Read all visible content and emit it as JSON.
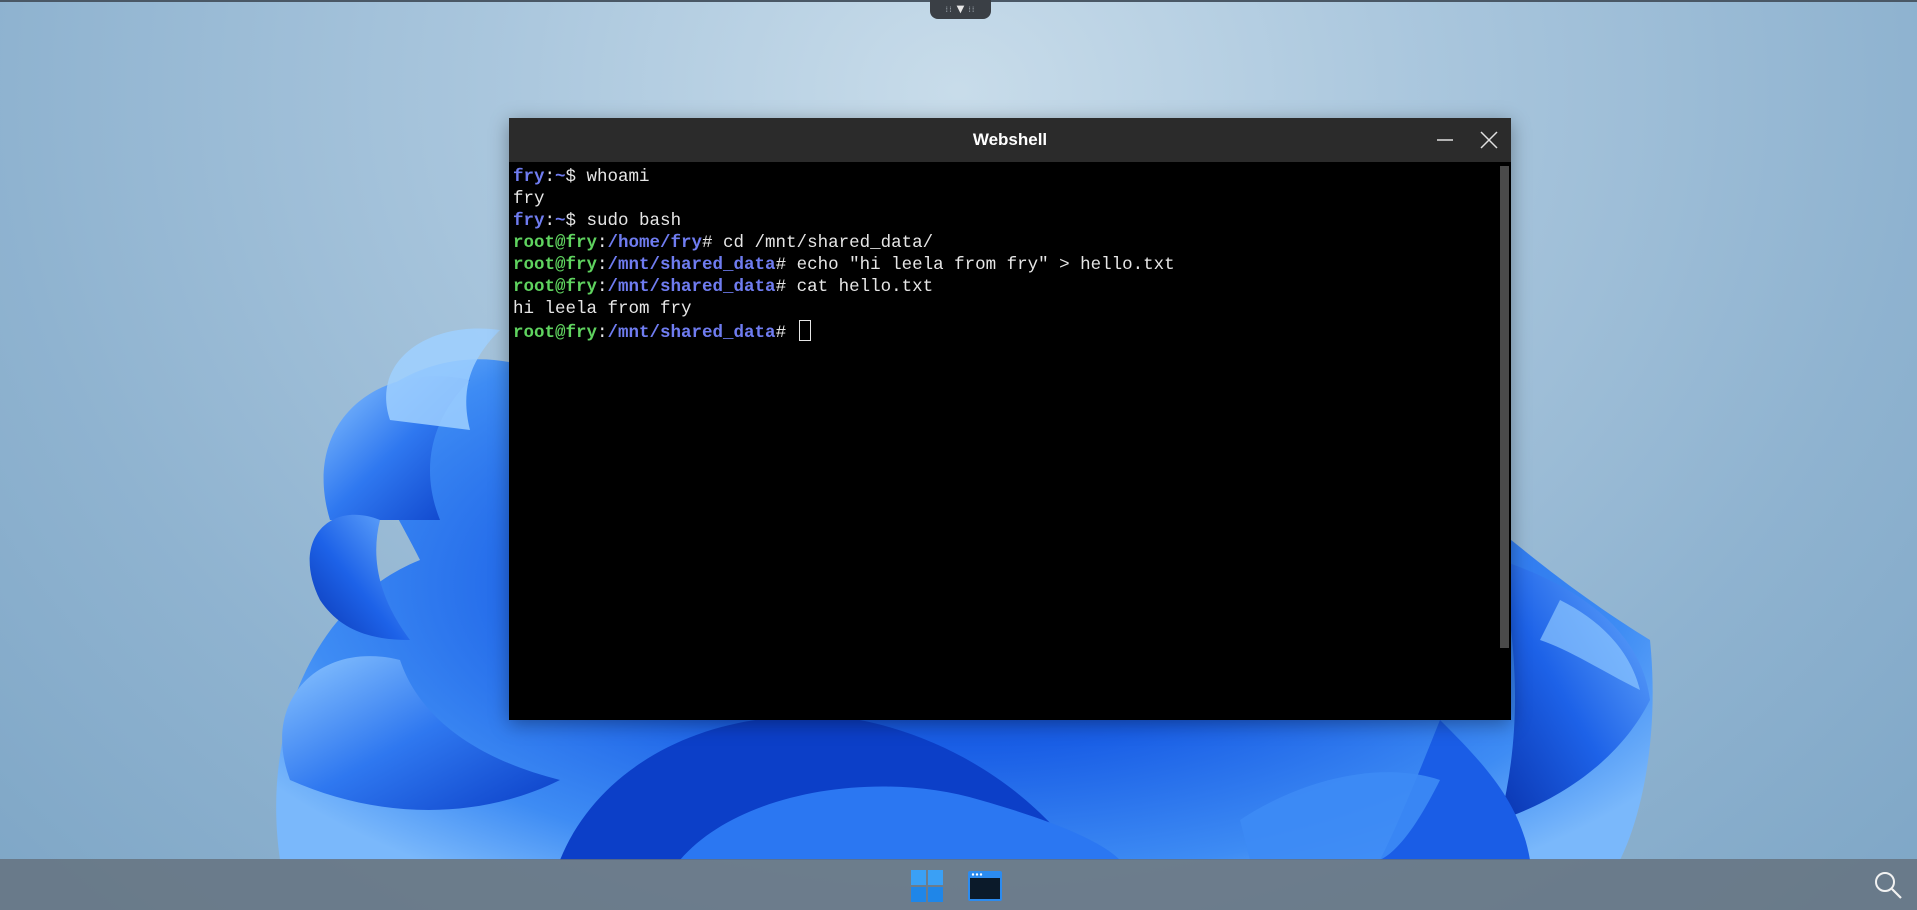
{
  "window": {
    "title": "Webshell"
  },
  "terminal": {
    "lines": [
      [
        {
          "t": "fry",
          "c": "u"
        },
        {
          "t": ":",
          "c": "w"
        },
        {
          "t": "~",
          "c": "u"
        },
        {
          "t": "$ whoami",
          "c": "w"
        }
      ],
      [
        {
          "t": "fry",
          "c": "w"
        }
      ],
      [
        {
          "t": "fry",
          "c": "u"
        },
        {
          "t": ":",
          "c": "w"
        },
        {
          "t": "~",
          "c": "u"
        },
        {
          "t": "$ sudo bash",
          "c": "w"
        }
      ],
      [
        {
          "t": "root@fry",
          "c": "g"
        },
        {
          "t": ":",
          "c": "w"
        },
        {
          "t": "/home/fry",
          "c": "b"
        },
        {
          "t": "# cd /mnt/shared_data/",
          "c": "w"
        }
      ],
      [
        {
          "t": "root@fry",
          "c": "g"
        },
        {
          "t": ":",
          "c": "w"
        },
        {
          "t": "/mnt/shared_data",
          "c": "b"
        },
        {
          "t": "# echo \"hi leela from fry\" > hello.txt",
          "c": "w"
        }
      ],
      [
        {
          "t": "root@fry",
          "c": "g"
        },
        {
          "t": ":",
          "c": "w"
        },
        {
          "t": "/mnt/shared_data",
          "c": "b"
        },
        {
          "t": "# cat hello.txt",
          "c": "w"
        }
      ],
      [
        {
          "t": "hi leela from fry",
          "c": "w"
        }
      ],
      [
        {
          "t": "root@fry",
          "c": "g"
        },
        {
          "t": ":",
          "c": "w"
        },
        {
          "t": "/mnt/shared_data",
          "c": "b"
        },
        {
          "t": "# ",
          "c": "w"
        }
      ]
    ]
  },
  "icons": {
    "minimize": "minimize-icon",
    "close": "close-icon",
    "start": "windows-start-icon",
    "terminal": "terminal-app-icon",
    "search": "search-icon",
    "handle": "chevron-down-icon"
  },
  "colors": {
    "prompt_user": "#6f7cf0",
    "prompt_root": "#5fd35f",
    "titlebar": "#2b2b2b",
    "accent": "#2b7de9"
  }
}
